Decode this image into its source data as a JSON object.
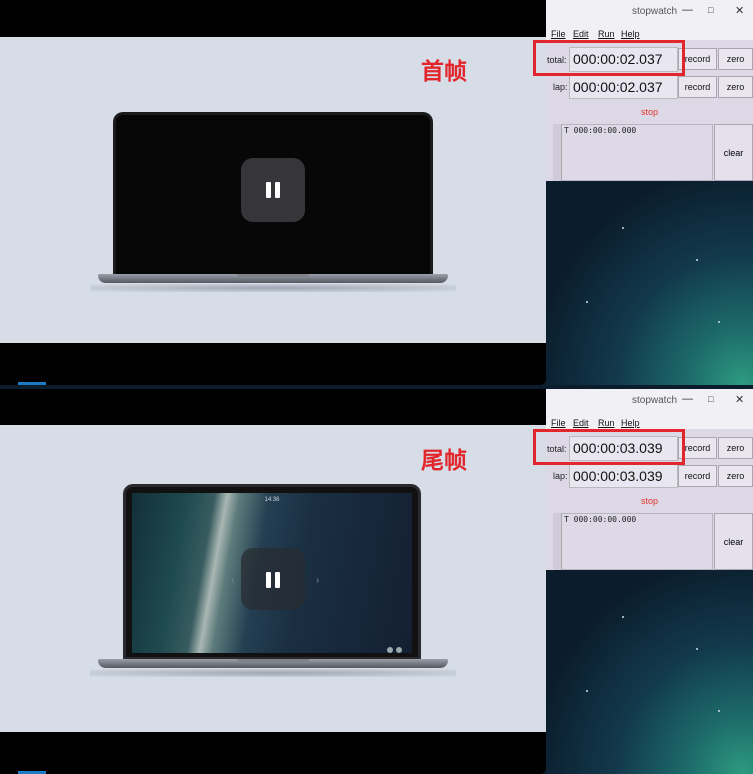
{
  "frames": [
    {
      "label": "首帧",
      "stopwatch": {
        "title": "stopwatch",
        "total_label": "total:",
        "total_value": "000:00:02.037",
        "lap_label": "lap:",
        "lap_value": "000:00:02.037"
      }
    },
    {
      "label": "尾帧",
      "stopwatch": {
        "title": "stopwatch",
        "total_label": "total:",
        "total_value": "000:00:03.039",
        "lap_label": "lap:",
        "lap_value": "000:00:03.039"
      }
    }
  ],
  "menu": {
    "file": "File",
    "edit": "Edit",
    "run": "Run",
    "help": "Help"
  },
  "buttons": {
    "record": "record",
    "zero": "zero",
    "stop": "stop",
    "clear": "clear"
  },
  "window_controls": {
    "minimize": "—",
    "maximize": "□",
    "close": "✕"
  },
  "log_line": "T 000:00:00.000",
  "laptop_screen": {
    "clock": "14:36",
    "nav_left": "‹",
    "nav_right": "›"
  },
  "icons": [
    "pause-icon",
    "minimize-icon",
    "maximize-icon",
    "close-icon",
    "scrollbar"
  ],
  "colors": {
    "annotation_red": "#e3262c",
    "stop_red": "#e5332a",
    "stage_bg": "#d6dde6",
    "window_bg": "#dcd8e6"
  }
}
